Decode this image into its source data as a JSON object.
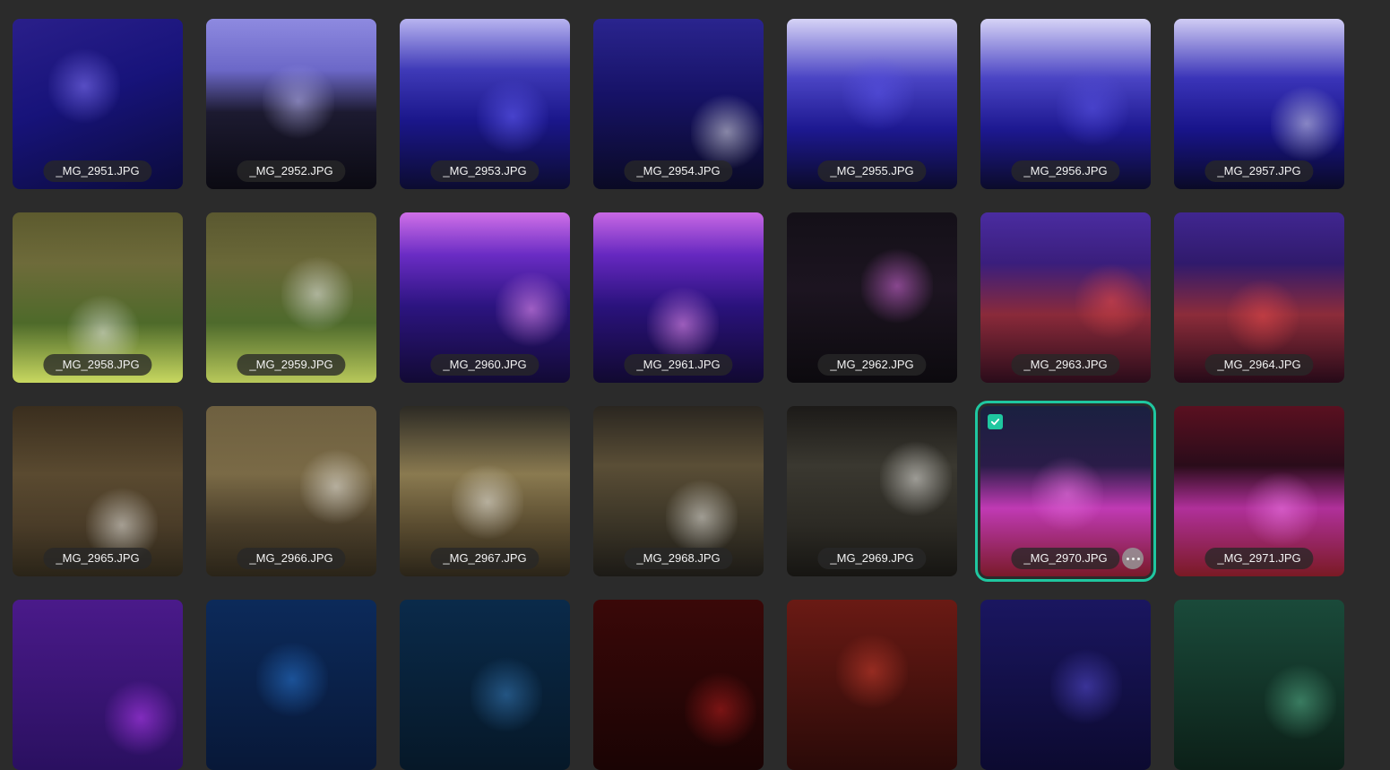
{
  "gallery": {
    "accent_color": "#1fc7a0",
    "items": [
      {
        "filename": "_MG_2951.JPG",
        "bg": "linear-gradient(160deg,#2a1f8a 0%,#17137a 45%,#0b0b3a 100%)",
        "highlight": "#8a7cff",
        "selected": false
      },
      {
        "filename": "_MG_2952.JPG",
        "bg": "linear-gradient(180deg,#8e8ae0 0%,#6c68c8 30%,#1c1a30 55%,#0b0a12 100%)",
        "highlight": "#c4c0ff",
        "selected": false
      },
      {
        "filename": "_MG_2953.JPG",
        "bg": "linear-gradient(180deg,#b8b4f0 0%,#3f3ab8 30%,#1a168a 60%,#0c0c30 100%)",
        "highlight": "#6a64ff",
        "selected": false
      },
      {
        "filename": "_MG_2954.JPG",
        "bg": "linear-gradient(180deg,#2a248e 0%,#161266 45%,#0a0a24 100%)",
        "highlight": "#e8e8f0",
        "selected": false
      },
      {
        "filename": "_MG_2955.JPG",
        "bg": "linear-gradient(180deg,#d6d3f6 0%,#4a44c4 35%,#1d1890 65%,#0b0b2a 100%)",
        "highlight": "#5b55e8",
        "selected": false
      },
      {
        "filename": "_MG_2956.JPG",
        "bg": "linear-gradient(180deg,#d6d3f6 0%,#4a44c4 35%,#1d1890 65%,#0b0b2a 100%)",
        "highlight": "#5b55e8",
        "selected": false
      },
      {
        "filename": "_MG_2957.JPG",
        "bg": "linear-gradient(180deg,#d0ccf4 0%,#3a34b8 35%,#18148a 65%,#0a0a26 100%)",
        "highlight": "#e0e0f0",
        "selected": false
      },
      {
        "filename": "_MG_2958.JPG",
        "bg": "linear-gradient(180deg,#5c5a2e 0%,#6e6b3a 30%,#4e6a2a 65%,#c8d860 100%)",
        "highlight": "#f0f0f0",
        "selected": false
      },
      {
        "filename": "_MG_2959.JPG",
        "bg": "linear-gradient(180deg,#5a5830 0%,#6a6838 30%,#4e6a2c 65%,#b8c85a 100%)",
        "highlight": "#f0f0f0",
        "selected": false
      },
      {
        "filename": "_MG_2960.JPG",
        "bg": "linear-gradient(180deg,#d070e8 0%,#6a2cc4 25%,#2c1480 55%,#120a34 100%)",
        "highlight": "#ff9cff",
        "selected": false
      },
      {
        "filename": "_MG_2961.JPG",
        "bg": "linear-gradient(180deg,#c868e4 0%,#6628c0 25%,#2a127c 55%,#110930 100%)",
        "highlight": "#ff9cff",
        "selected": false
      },
      {
        "filename": "_MG_2962.JPG",
        "bg": "linear-gradient(180deg,#141018 0%,#1c1420 45%,#0c0a0e 100%)",
        "highlight": "#e070e8",
        "selected": false
      },
      {
        "filename": "_MG_2963.JPG",
        "bg": "linear-gradient(180deg,#4a2ca0 0%,#3a1e7c 30%,#8a2a3a 60%,#2a0c1a 100%)",
        "highlight": "#e84a4a",
        "selected": false
      },
      {
        "filename": "_MG_2964.JPG",
        "bg": "linear-gradient(180deg,#402690 0%,#301a6c 30%,#8c2c3a 60%,#260a18 100%)",
        "highlight": "#e84a4a",
        "selected": false
      },
      {
        "filename": "_MG_2965.JPG",
        "bg": "linear-gradient(180deg,#3a2e1e 0%,#5a4a30 40%,#4a3c28 70%,#2a2418 100%)",
        "highlight": "#f0efea",
        "selected": false
      },
      {
        "filename": "_MG_2966.JPG",
        "bg": "linear-gradient(180deg,#6e6040 0%,#7a6a46 40%,#4a3e2a 70%,#2a2418 100%)",
        "highlight": "#f0efea",
        "selected": false
      },
      {
        "filename": "_MG_2967.JPG",
        "bg": "linear-gradient(180deg,#2c2a24 0%,#8a7a50 40%,#5a4c30 70%,#2a2418 100%)",
        "highlight": "#f0efea",
        "selected": false
      },
      {
        "filename": "_MG_2968.JPG",
        "bg": "linear-gradient(180deg,#2a2620 0%,#5a4e36 35%,#3a3426 70%,#1c1a16 100%)",
        "highlight": "#f0efea",
        "selected": false
      },
      {
        "filename": "_MG_2969.JPG",
        "bg": "linear-gradient(180deg,#1c1a18 0%,#3a3830 35%,#2c2a24 70%,#161512 100%)",
        "highlight": "#f0efea",
        "selected": false
      },
      {
        "filename": "_MG_2970.JPG",
        "bg": "linear-gradient(180deg,#1a2040 0%,#2a1c48 35%,#c03ab4 60%,#7a1a2a 100%)",
        "highlight": "#f07ae8",
        "selected": true
      },
      {
        "filename": "_MG_2971.JPG",
        "bg": "linear-gradient(180deg,#5a1020 0%,#2a0c1a 35%,#b0309a 60%,#7a1a24 100%)",
        "highlight": "#f07ae8",
        "selected": false
      },
      {
        "filename": "",
        "bg": "linear-gradient(180deg,#4a1a8a 0%,#2a1060 100%)",
        "highlight": "#c040ff",
        "selected": false
      },
      {
        "filename": "",
        "bg": "linear-gradient(180deg,#0c2a5a 0%,#081838 100%)",
        "highlight": "#2a7ad8",
        "selected": false
      },
      {
        "filename": "",
        "bg": "linear-gradient(180deg,#0a2a4a 0%,#061828 100%)",
        "highlight": "#3a80c0",
        "selected": false
      },
      {
        "filename": "",
        "bg": "linear-gradient(180deg,#3a0808 0%,#1a0404 100%)",
        "highlight": "#c02020",
        "selected": false
      },
      {
        "filename": "",
        "bg": "linear-gradient(180deg,#6a1a14 0%,#2a0a08 100%)",
        "highlight": "#d04030",
        "selected": false
      },
      {
        "filename": "",
        "bg": "linear-gradient(180deg,#1a1660 0%,#0c0a30 100%)",
        "highlight": "#5a50d8",
        "selected": false
      },
      {
        "filename": "",
        "bg": "linear-gradient(180deg,#1a4a3a 0%,#0c2018 100%)",
        "highlight": "#5ab890",
        "selected": false
      }
    ]
  }
}
